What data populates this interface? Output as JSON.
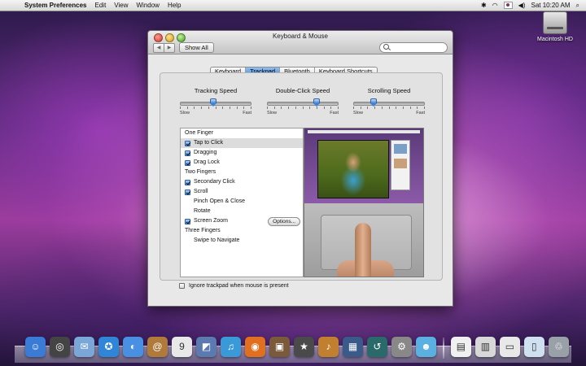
{
  "menubar": {
    "apple_glyph": "",
    "app_name": "System Preferences",
    "menus": [
      "Edit",
      "View",
      "Window",
      "Help"
    ],
    "clock": "Sat 10:20 AM"
  },
  "desktop": {
    "drive_label": "Macintosh HD"
  },
  "window": {
    "title": "Keyboard & Mouse",
    "show_all_label": "Show All",
    "search_placeholder": "",
    "back_glyph": "◀",
    "forward_glyph": "▶"
  },
  "tabs": [
    {
      "label": "Keyboard",
      "active": false
    },
    {
      "label": "Trackpad",
      "active": true
    },
    {
      "label": "Bluetooth",
      "active": false
    },
    {
      "label": "Keyboard Shortcuts",
      "active": false
    }
  ],
  "sliders": [
    {
      "title": "Tracking Speed",
      "min_label": "Slow",
      "max_label": "Fast",
      "value": 0.45
    },
    {
      "title": "Double-Click Speed",
      "min_label": "Slow",
      "max_label": "Fast",
      "value": 0.7
    },
    {
      "title": "Scrolling Speed",
      "min_label": "Slow",
      "max_label": "Fast",
      "value": 0.25
    }
  ],
  "gesture_list": {
    "groups": [
      {
        "label": "One Finger",
        "items": [
          {
            "label": "Tap to Click",
            "checkbox": true,
            "checked": true,
            "selected": true
          },
          {
            "label": "Dragging",
            "checkbox": true,
            "checked": true
          },
          {
            "label": "Drag Lock",
            "checkbox": true,
            "checked": true
          }
        ]
      },
      {
        "label": "Two Fingers",
        "items": [
          {
            "label": "Secondary Click",
            "checkbox": true,
            "checked": true
          },
          {
            "label": "Scroll",
            "checkbox": true,
            "checked": true
          },
          {
            "label": "Pinch Open & Close",
            "checkbox": false
          },
          {
            "label": "Rotate",
            "checkbox": false
          },
          {
            "label": "Screen Zoom",
            "checkbox": true,
            "checked": true,
            "button": "Options..."
          }
        ]
      },
      {
        "label": "Three Fingers",
        "items": [
          {
            "label": "Swipe to Navigate",
            "checkbox": false
          }
        ]
      }
    ]
  },
  "ignore_trackpad": {
    "label": "Ignore trackpad when mouse is present",
    "checked": false
  },
  "dock": {
    "apps": [
      {
        "name": "finder-icon",
        "glyph": "☺",
        "color": "#3a7bd5"
      },
      {
        "name": "dashboard-icon",
        "glyph": "◎",
        "color": "#444"
      },
      {
        "name": "mail-icon",
        "glyph": "✉",
        "color": "#7aa7d8"
      },
      {
        "name": "safari-icon",
        "glyph": "✪",
        "color": "#2f86d8"
      },
      {
        "name": "ichat-icon",
        "glyph": "◐",
        "color": "#4a90e2"
      },
      {
        "name": "address-book-icon",
        "glyph": "@",
        "color": "#b07a3a"
      },
      {
        "name": "ical-icon",
        "glyph": "9",
        "color": "#e8e8e8"
      },
      {
        "name": "iphoto-icon",
        "glyph": "◩",
        "color": "#5a7ab0"
      },
      {
        "name": "itunes-icon",
        "glyph": "♫",
        "color": "#3a9ad8"
      },
      {
        "name": "firefox-icon",
        "glyph": "◉",
        "color": "#e07020"
      },
      {
        "name": "preview-icon",
        "glyph": "▣",
        "color": "#7a5a3a"
      },
      {
        "name": "imovie-icon",
        "glyph": "★",
        "color": "#4a4a4a"
      },
      {
        "name": "garageband-icon",
        "glyph": "♪",
        "color": "#c08030"
      },
      {
        "name": "spaces-icon",
        "glyph": "▦",
        "color": "#3a5a8a"
      },
      {
        "name": "time-machine-icon",
        "glyph": "↺",
        "color": "#2a6a6a"
      },
      {
        "name": "system-preferences-icon",
        "glyph": "⚙",
        "color": "#888"
      },
      {
        "name": "messenger-icon",
        "glyph": "☻",
        "color": "#5ab0e0"
      }
    ],
    "docs": [
      {
        "name": "document-icon",
        "glyph": "▤",
        "color": "#f0f0f0"
      },
      {
        "name": "applications-stack-icon",
        "glyph": "▥",
        "color": "#d8d8d8"
      },
      {
        "name": "downloads-stack-icon",
        "glyph": "▭",
        "color": "#e8e8e8"
      },
      {
        "name": "documents-stack-icon",
        "glyph": "▯",
        "color": "#cfe0f0"
      },
      {
        "name": "trash-icon",
        "glyph": "♲",
        "color": "#9aa0a8"
      }
    ]
  }
}
